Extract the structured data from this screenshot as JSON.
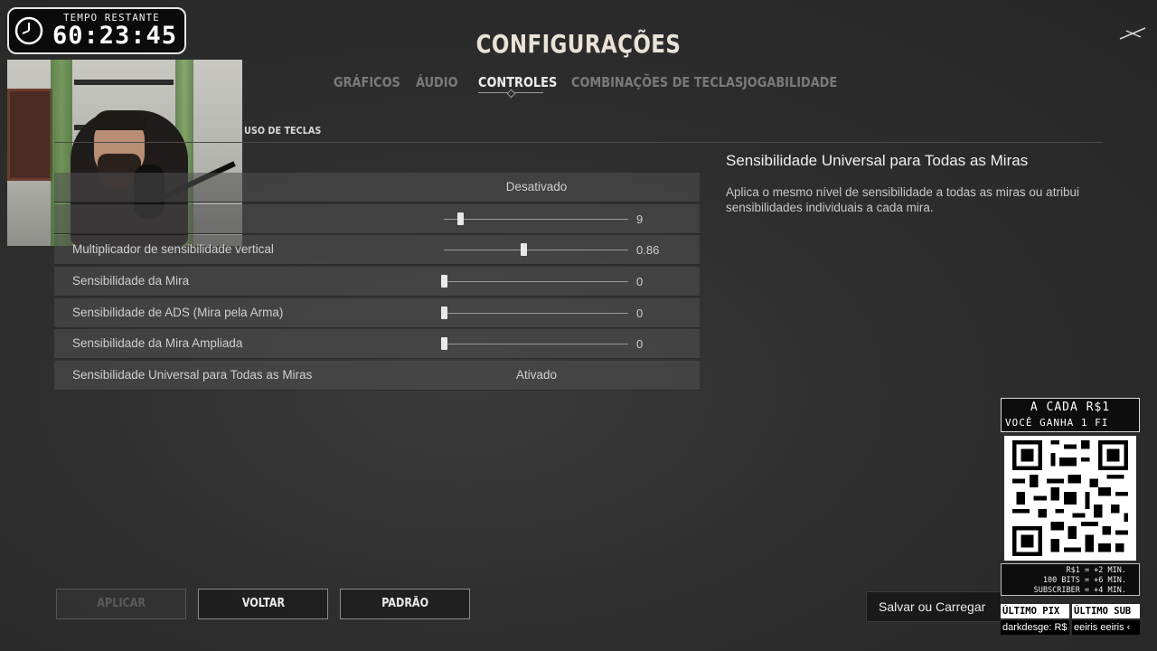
{
  "overlay": {
    "timer_label": "TEMPO RESTANTE",
    "timer_value": "60:23:45"
  },
  "header": {
    "title": "CONFIGURAÇÕES",
    "tabs": [
      {
        "label": "GRÁFICOS",
        "active": false
      },
      {
        "label": "ÁUDIO",
        "active": false
      },
      {
        "label": "CONTROLES",
        "active": true
      },
      {
        "label": "COMBINAÇÕES DE TECLAS",
        "active": false
      },
      {
        "label": "JOGABILIDADE",
        "active": false
      }
    ],
    "close_icon": "close-x-icon"
  },
  "subtab": {
    "label": "USO DE TECLAS"
  },
  "settings": {
    "rows": [
      {
        "label": "",
        "type": "toggle",
        "value": "Desativado"
      },
      {
        "label": "",
        "type": "slider",
        "value": "9",
        "fraction": 0.09
      },
      {
        "label": "Multiplicador de sensibilidade vertical",
        "type": "slider",
        "value": "0.86",
        "fraction": 0.43
      },
      {
        "label": "Sensibilidade da Mira",
        "type": "slider",
        "value": "0",
        "fraction": 0.0
      },
      {
        "label": "Sensibilidade de ADS (Mira pela Arma)",
        "type": "slider",
        "value": "0",
        "fraction": 0.0
      },
      {
        "label": "Sensibilidade da Mira Ampliada",
        "type": "slider",
        "value": "0",
        "fraction": 0.0
      },
      {
        "label": "Sensibilidade Universal para Todas as Miras",
        "type": "toggle",
        "value": "Ativado"
      }
    ]
  },
  "description": {
    "title": "Sensibilidade Universal para Todas as Miras",
    "body": "Aplica o mesmo nível de sensibilidade a todas as miras ou atribui sensibilidades individuais a cada mira."
  },
  "footer": {
    "apply_label": "APLICAR",
    "back_label": "VOLTAR",
    "default_label": "PADRÃO",
    "save_load_label": "Salvar ou Carregar"
  },
  "donation": {
    "line1": "A CADA R$1",
    "line2": "VOCÊ GANHA 1 FI",
    "info1": "R$1 = +2 MIN.",
    "info2": "100 BITS = +6 MIN.",
    "info3": "SUBSCRIBER = +4 MIN.",
    "last_pix_label": "ÚLTIMO PIX",
    "last_sub_label": "ÚLTIMO SUB",
    "last_pix_value": "darkdesge: R$",
    "last_sub_value": "eeiris  eeiris  ‹"
  }
}
